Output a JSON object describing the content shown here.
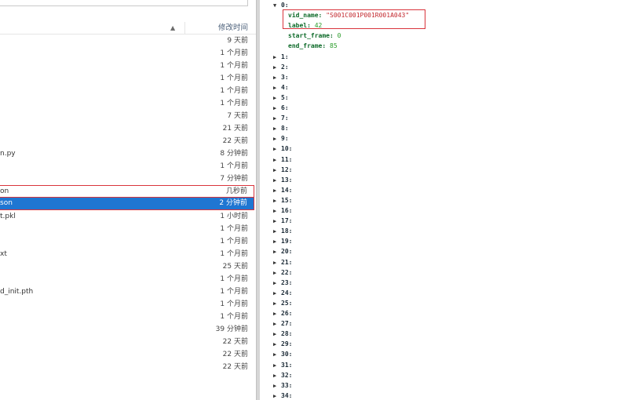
{
  "file_list": {
    "header": {
      "modified_label": "修改时间"
    },
    "rows": [
      {
        "name": "",
        "time": "9 天前"
      },
      {
        "name": "",
        "time": "1 个月前"
      },
      {
        "name": "",
        "time": "1 个月前"
      },
      {
        "name": "",
        "time": "1 个月前"
      },
      {
        "name": "",
        "time": "1 个月前"
      },
      {
        "name": "",
        "time": "1 个月前"
      },
      {
        "name": "",
        "time": "7 天前"
      },
      {
        "name": "",
        "time": "21 天前"
      },
      {
        "name": "",
        "time": "22 天前"
      },
      {
        "name": "n.py",
        "time": "8 分钟前"
      },
      {
        "name": "",
        "time": "1 个月前"
      },
      {
        "name": "",
        "time": "7 分钟前"
      },
      {
        "name": "on",
        "time": "几秒前",
        "state": "outlined"
      },
      {
        "name": "son",
        "time": "2 分钟前",
        "state": "selected"
      },
      {
        "name": "t.pkl",
        "time": "1 小时前"
      },
      {
        "name": "",
        "time": "1 个月前"
      },
      {
        "name": "",
        "time": "1 个月前"
      },
      {
        "name": "xt",
        "time": "1 个月前"
      },
      {
        "name": "",
        "time": "25 天前"
      },
      {
        "name": "",
        "time": "1 个月前"
      },
      {
        "name": "d_init.pth",
        "time": "1 个月前"
      },
      {
        "name": "",
        "time": "1 个月前"
      },
      {
        "name": "",
        "time": "1 个月前"
      },
      {
        "name": "",
        "time": "39 分钟前"
      },
      {
        "name": "",
        "time": "22 天前"
      },
      {
        "name": "",
        "time": "22 天前"
      },
      {
        "name": "",
        "time": "22 天前"
      }
    ]
  },
  "json_viewer": {
    "expanded_node": {
      "key": "0:",
      "props": [
        {
          "key": "vid_name:",
          "value": "\"S001C001P001R001A043\"",
          "kind": "str"
        },
        {
          "key": "label:",
          "value": "42",
          "kind": "num"
        },
        {
          "key": "start_frame:",
          "value": "0",
          "kind": "num"
        },
        {
          "key": "end_frame:",
          "value": "85",
          "kind": "num"
        }
      ]
    },
    "collapsed_nodes": [
      "1:",
      "2:",
      "3:",
      "4:",
      "5:",
      "6:",
      "7:",
      "8:",
      "9:",
      "10:",
      "11:",
      "12:",
      "13:",
      "14:",
      "15:",
      "16:",
      "17:",
      "18:",
      "19:",
      "20:",
      "21:",
      "22:",
      "23:",
      "24:",
      "25:",
      "26:",
      "27:",
      "28:",
      "29:",
      "30:",
      "31:",
      "32:",
      "33:",
      "34:"
    ],
    "icons": {
      "expanded": "triangle-down-icon",
      "collapsed": "triangle-right-icon"
    }
  },
  "colors": {
    "selection": "#1f76d2",
    "highlight_border": "#d9343c",
    "string_value": "#c2272d",
    "number_value": "#2a9c2a",
    "property_key": "#0e6b2a"
  }
}
